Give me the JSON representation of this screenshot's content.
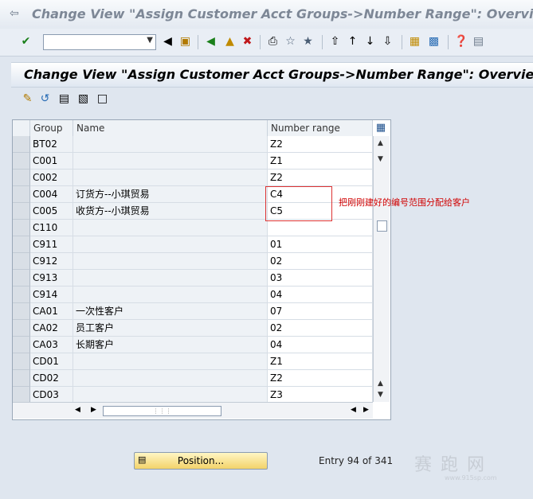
{
  "window": {
    "title": "Change View \"Assign Customer Acct Groups->Number Range\": Overview"
  },
  "screen_title": "Change View \"Assign Customer Acct Groups->Number Range\": Overview",
  "table": {
    "columns": [
      "Group",
      "Name",
      "Number range"
    ],
    "rows": [
      {
        "group": "BT02",
        "name": "",
        "range": "Z2"
      },
      {
        "group": "C001",
        "name": "",
        "range": "Z1"
      },
      {
        "group": "C002",
        "name": "",
        "range": "Z2"
      },
      {
        "group": "C004",
        "name": "订货方--小琪贸易",
        "range": "C4"
      },
      {
        "group": "C005",
        "name": "收货方--小琪贸易",
        "range": "C5"
      },
      {
        "group": "C110",
        "name": "",
        "range": ""
      },
      {
        "group": "C911",
        "name": "",
        "range": "01"
      },
      {
        "group": "C912",
        "name": "",
        "range": "02"
      },
      {
        "group": "C913",
        "name": "",
        "range": "03"
      },
      {
        "group": "C914",
        "name": "",
        "range": "04"
      },
      {
        "group": "CA01",
        "name": "一次性客户",
        "range": "07"
      },
      {
        "group": "CA02",
        "name": "员工客户",
        "range": "02"
      },
      {
        "group": "CA03",
        "name": "长期客户",
        "range": "04"
      },
      {
        "group": "CD01",
        "name": "",
        "range": "Z1"
      },
      {
        "group": "CD02",
        "name": "",
        "range": "Z2"
      },
      {
        "group": "CD03",
        "name": "",
        "range": "Z3"
      }
    ]
  },
  "annotation": "把刚刚建好的编号范围分配给客户",
  "position_button": "Position...",
  "entry_status": "Entry 94 of 341",
  "watermark": {
    "text": "赛 跑 网",
    "url": "www.915sp.com"
  },
  "colors": {
    "annotation": "#d00000",
    "button_yellow": "#f3d36a"
  }
}
